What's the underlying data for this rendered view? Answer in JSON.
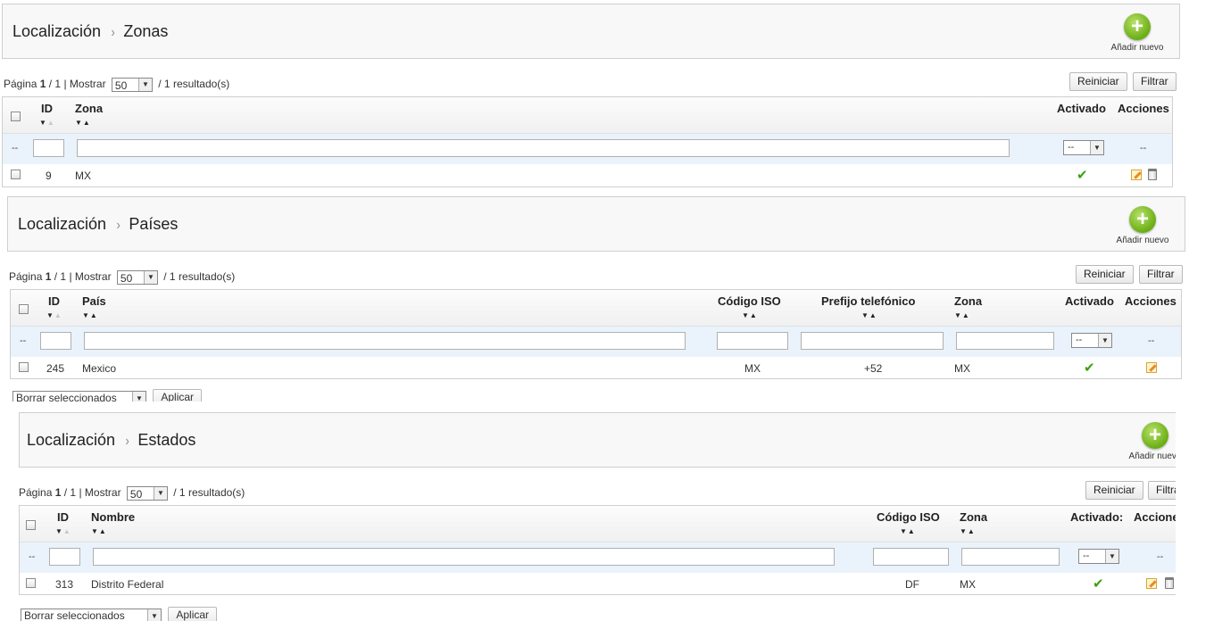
{
  "common": {
    "breadcrumb_root": "Localización",
    "breadcrumb_separator": "›",
    "add_new_label": "Añadir nuevo",
    "page_word": "Página",
    "page_current": "1",
    "page_total": "1",
    "show_word": "Mostrar",
    "per_page": "50",
    "results_text": "/ 1 resultado(s)",
    "reset_label": "Reiniciar",
    "filter_label": "Filtrar",
    "filter_dash": "--",
    "select_arrow": "▼",
    "sort_down": "▼",
    "sort_up": "▲",
    "check_mark": "✔",
    "bulk_select": "Borrar seleccionados",
    "apply_label": "Aplicar",
    "accent_green": "#6aae14"
  },
  "zonas": {
    "title": "Zonas",
    "headers": {
      "id": "ID",
      "zone": "Zona",
      "active": "Activado",
      "actions": "Acciones"
    },
    "row": {
      "id": "9",
      "zone": "MX",
      "active": true
    }
  },
  "paises": {
    "title": "Países",
    "headers": {
      "id": "ID",
      "country": "País",
      "iso": "Código ISO",
      "prefix": "Prefijo telefónico",
      "zone": "Zona",
      "active": "Activado",
      "actions": "Acciones"
    },
    "row": {
      "id": "245",
      "country": "Mexico",
      "iso": "MX",
      "prefix": "+52",
      "zone": "MX",
      "active": true
    }
  },
  "estados": {
    "title": "Estados",
    "headers": {
      "id": "ID",
      "name": "Nombre",
      "iso": "Código ISO",
      "zone": "Zona",
      "active": "Activado:",
      "actions": "Acciones"
    },
    "row": {
      "id": "313",
      "name": "Distrito Federal",
      "iso": "DF",
      "zone": "MX",
      "active": true
    }
  }
}
